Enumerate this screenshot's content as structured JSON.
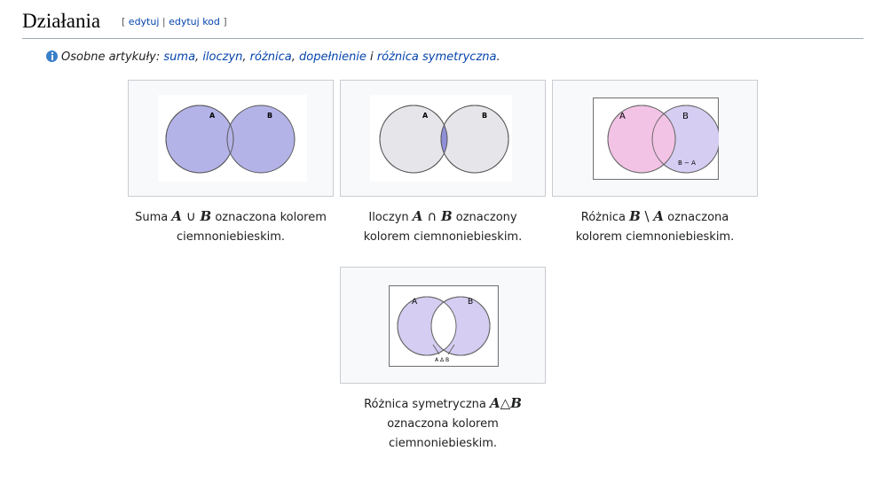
{
  "section": {
    "title": "Działania",
    "edit_open": "[ ",
    "edit_link": "edytuj",
    "edit_sep": " | ",
    "edit_code_link": "edytuj kod",
    "edit_close": " ]"
  },
  "hatnote": {
    "prefix": "Osobne artykuły: ",
    "links": [
      "suma",
      "iloczyn",
      "różnica",
      "dopełnienie",
      "różnica symetryczna"
    ],
    "sep1": ", ",
    "sep2": ", ",
    "sep3": ", ",
    "conj": " i ",
    "end": "."
  },
  "figures": [
    {
      "caption_before": "Suma ",
      "math_a": "A",
      "op": " ∪ ",
      "math_b": "B",
      "caption_line1_after": " oznaczona kolorem",
      "caption_line2": "ciemnoniebieskim.",
      "labels": [
        "A",
        "B"
      ]
    },
    {
      "caption_before": "Iloczyn ",
      "math_a": "A",
      "op": " ∩ ",
      "math_b": "B",
      "caption_line1_after": " oznaczony",
      "caption_line2": "kolorem ciemnoniebieskim.",
      "labels": [
        "A",
        "B"
      ]
    },
    {
      "caption_before": "Różnica ",
      "math_a": "B",
      "op": " \\ ",
      "math_b": "A",
      "caption_line1_after": " oznaczona",
      "caption_line2": "kolorem ciemnoniebieskim.",
      "labels": [
        "A",
        "B",
        "B − A"
      ]
    },
    {
      "caption_before": "Różnica symetryczna ",
      "math_a": "A",
      "op": "△",
      "math_b": "B",
      "caption_line2": "oznaczona kolorem",
      "caption_line3": "ciemnoniebieskim.",
      "labels": [
        "A",
        "B",
        "A Δ B"
      ]
    }
  ],
  "colors": {
    "venn_blue": "#b3b3e8",
    "venn_pink": "#f3c3e6",
    "venn_purple": "#d5cdf2",
    "venn_gray": "#e6e6e6",
    "venn_dark": "#8f8fd9",
    "link": "#0645ad"
  }
}
